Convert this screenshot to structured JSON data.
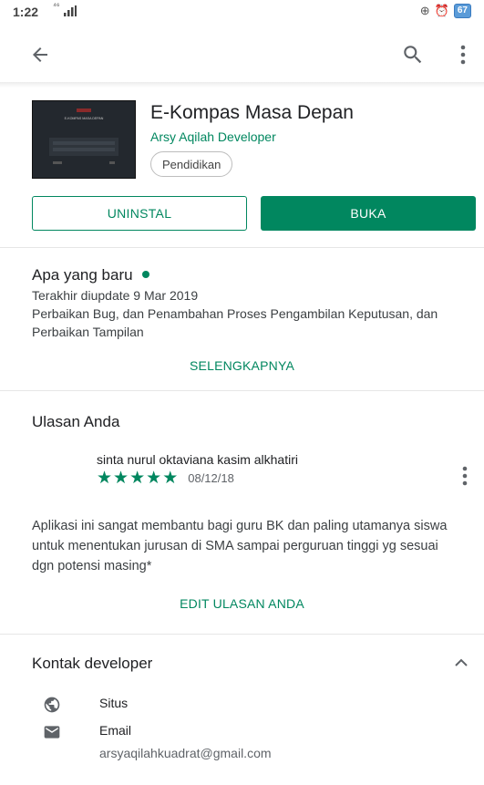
{
  "status_bar": {
    "time": "1:22",
    "signal": "⁴⁶",
    "battery": "67"
  },
  "app_bar": {
    "back_icon": "arrow-back-icon",
    "search_icon": "search-icon",
    "more_icon": "more-vert-icon"
  },
  "app": {
    "name": "E-Kompas Masa Depan",
    "developer": "Arsy Aqilah Developer",
    "category": "Pendidikan",
    "thumb_title": "E-KOMPAS MASA DEPAN"
  },
  "actions": {
    "uninstall_label": "UNINSTAL",
    "open_label": "BUKA"
  },
  "whats_new": {
    "title": "Apa yang baru",
    "updated": "Terakhir diupdate 9 Mar 2019",
    "notes": "Perbaikan Bug, dan Penambahan Proses Pengambilan Keputusan, dan Perbaikan Tampilan",
    "more_label": "SELENGKAPNYA"
  },
  "your_review": {
    "title": "Ulasan Anda",
    "reviewer": "sinta nurul oktaviana kasim alkhatiri",
    "rating": 5,
    "date": "08/12/18",
    "text": "Aplikasi ini sangat membantu bagi guru BK dan paling utamanya siswa untuk menentukan jurusan di SMA sampai perguruan tinggi yg sesuai dgn potensi masing*",
    "edit_label": "EDIT ULASAN ANDA"
  },
  "developer_contact": {
    "title": "Kontak developer",
    "website_label": "Situs",
    "email_label": "Email",
    "email_value": "arsyaqilahkuadrat@gmail.com"
  },
  "colors": {
    "accent": "#01875f",
    "text": "#202124",
    "divider": "#e6e6e6"
  }
}
